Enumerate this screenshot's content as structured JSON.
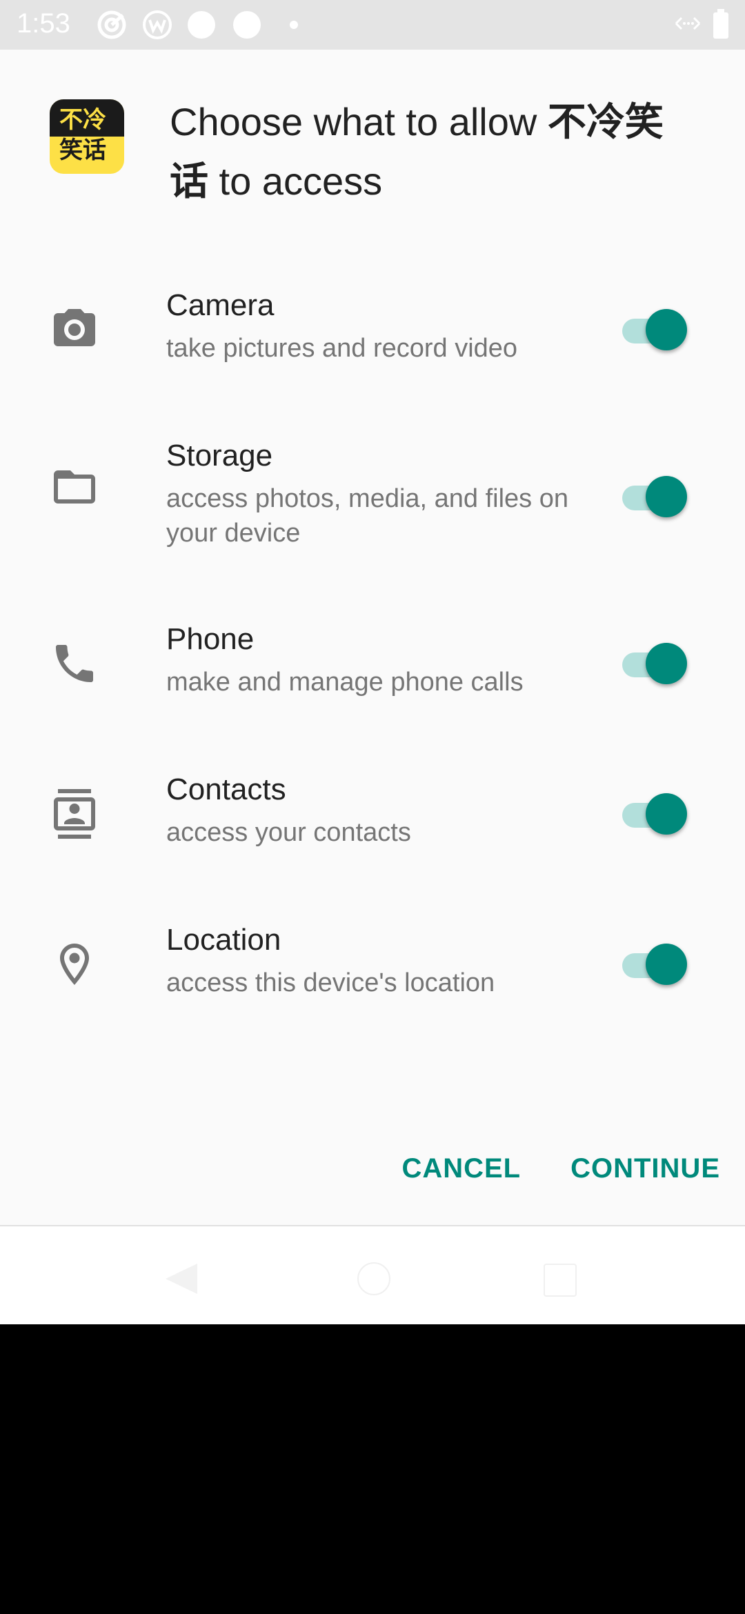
{
  "status_bar": {
    "time": "1:53",
    "icons": [
      "target-icon",
      "w-icon",
      "circle-icon",
      "circle-icon",
      "dot-icon",
      "vpn-icon",
      "battery-icon"
    ]
  },
  "dialog": {
    "app_icon_text_top": "不冷",
    "app_icon_text_bottom": "笑话",
    "title_prefix": "Choose what to allow ",
    "app_name": "不冷笑话",
    "title_suffix": " to access",
    "permissions": [
      {
        "name": "Camera",
        "description": "take pictures and record video",
        "icon": "camera-icon",
        "enabled": true
      },
      {
        "name": "Storage",
        "description": "access photos, media, and files on your device",
        "icon": "folder-icon",
        "enabled": true
      },
      {
        "name": "Phone",
        "description": "make and manage phone calls",
        "icon": "phone-icon",
        "enabled": true
      },
      {
        "name": "Contacts",
        "description": "access your contacts",
        "icon": "contacts-icon",
        "enabled": true
      },
      {
        "name": "Location",
        "description": "access this device's location",
        "icon": "location-icon",
        "enabled": true
      }
    ],
    "cancel_label": "CANCEL",
    "continue_label": "CONTINUE"
  },
  "colors": {
    "accent": "#00897b",
    "track": "#b2dfdb",
    "app_icon_yellow": "#fde046"
  }
}
